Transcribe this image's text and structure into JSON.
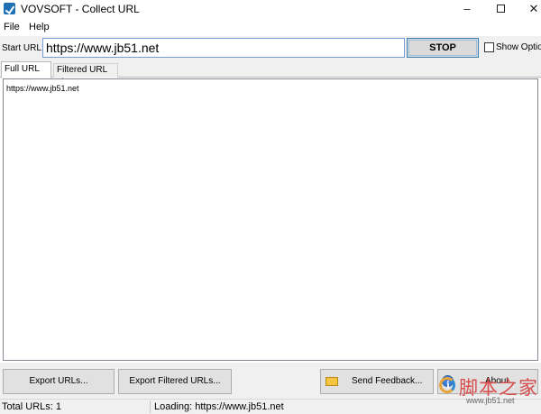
{
  "window": {
    "title": "VOVSOFT - Collect URL",
    "minimize_glyph": "–",
    "close_glyph": "✕"
  },
  "menu": {
    "items": [
      {
        "label": "File"
      },
      {
        "label": "Help"
      }
    ]
  },
  "url_bar": {
    "label": "Start URL:",
    "value": "https://www.jb51.net",
    "stop_label": "STOP",
    "show_options_label": "Show Options",
    "show_options_checked": false
  },
  "tabs": [
    {
      "label": "Full URL List",
      "active": true
    },
    {
      "label": "Filtered URL List",
      "active": false
    }
  ],
  "url_list": {
    "items": [
      "https://www.jb51.net"
    ]
  },
  "buttons": {
    "export_urls": "Export URLs...",
    "export_filtered": "Export Filtered URLs...",
    "send_feedback": "Send Feedback...",
    "about": "About..."
  },
  "status": {
    "total": "Total URLs: 1",
    "loading": "Loading: https://www.jb51.net"
  },
  "watermark": {
    "text": "脚本之家",
    "sub": "www.jb51.net"
  },
  "icons": {
    "app": "app-logo-icon",
    "feedback": "envelope-icon",
    "about": "info-icon"
  },
  "colors": {
    "accent": "#3c7fb1",
    "panel_bg": "#f0f0f0",
    "watermark": "#d84c4c"
  }
}
